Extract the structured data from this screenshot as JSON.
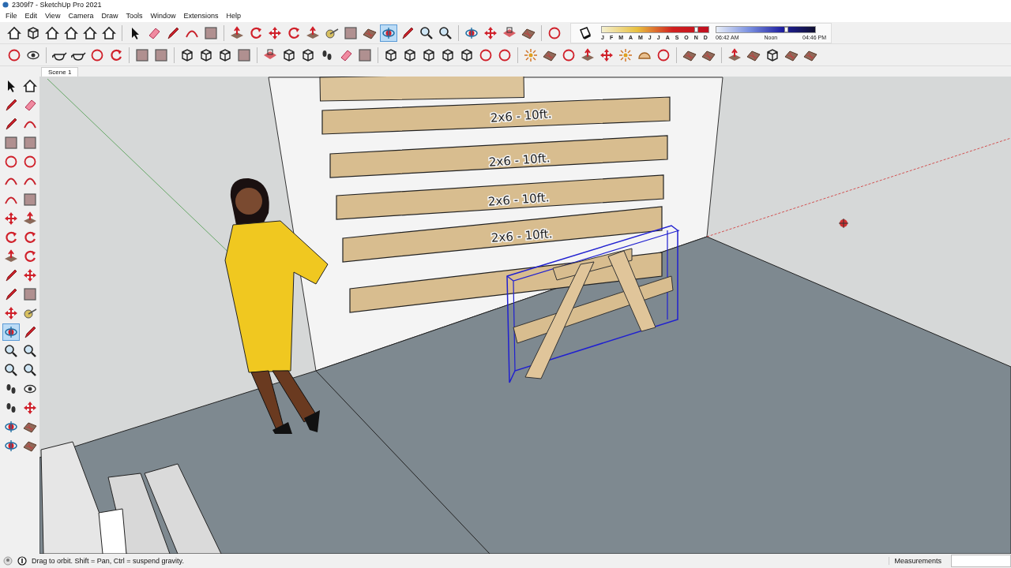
{
  "window": {
    "title": "2309f7 - SketchUp Pro 2021"
  },
  "menu": [
    "File",
    "Edit",
    "View",
    "Camera",
    "Draw",
    "Tools",
    "Window",
    "Extensions",
    "Help"
  ],
  "toolbar": {
    "orbit_button": {
      "selected": true
    }
  },
  "shadow_settings": {
    "months": [
      "J",
      "F",
      "M",
      "A",
      "M",
      "J",
      "J",
      "A",
      "S",
      "O",
      "N",
      "D"
    ],
    "date_slider": {
      "level": 0.88
    },
    "time_slider": {
      "level": 0.7
    },
    "time_labels": [
      "06:42 AM",
      "Noon",
      "04:46 PM"
    ]
  },
  "scene_tabs": [
    {
      "label": "Scene 1",
      "selected": true
    }
  ],
  "left_toolbar": {
    "orbit_button": {
      "selected": true
    }
  },
  "viewport": {
    "dimension_labels": [
      "2x6 - 10ft.",
      "2x6 - 10ft.",
      "2x6 - 10ft.",
      "2x6 - 10ft."
    ]
  },
  "status_bar": {
    "hint": "Drag to orbit. Shift = Pan, Ctrl = suspend gravity.",
    "measurements_label": "Measurements"
  }
}
